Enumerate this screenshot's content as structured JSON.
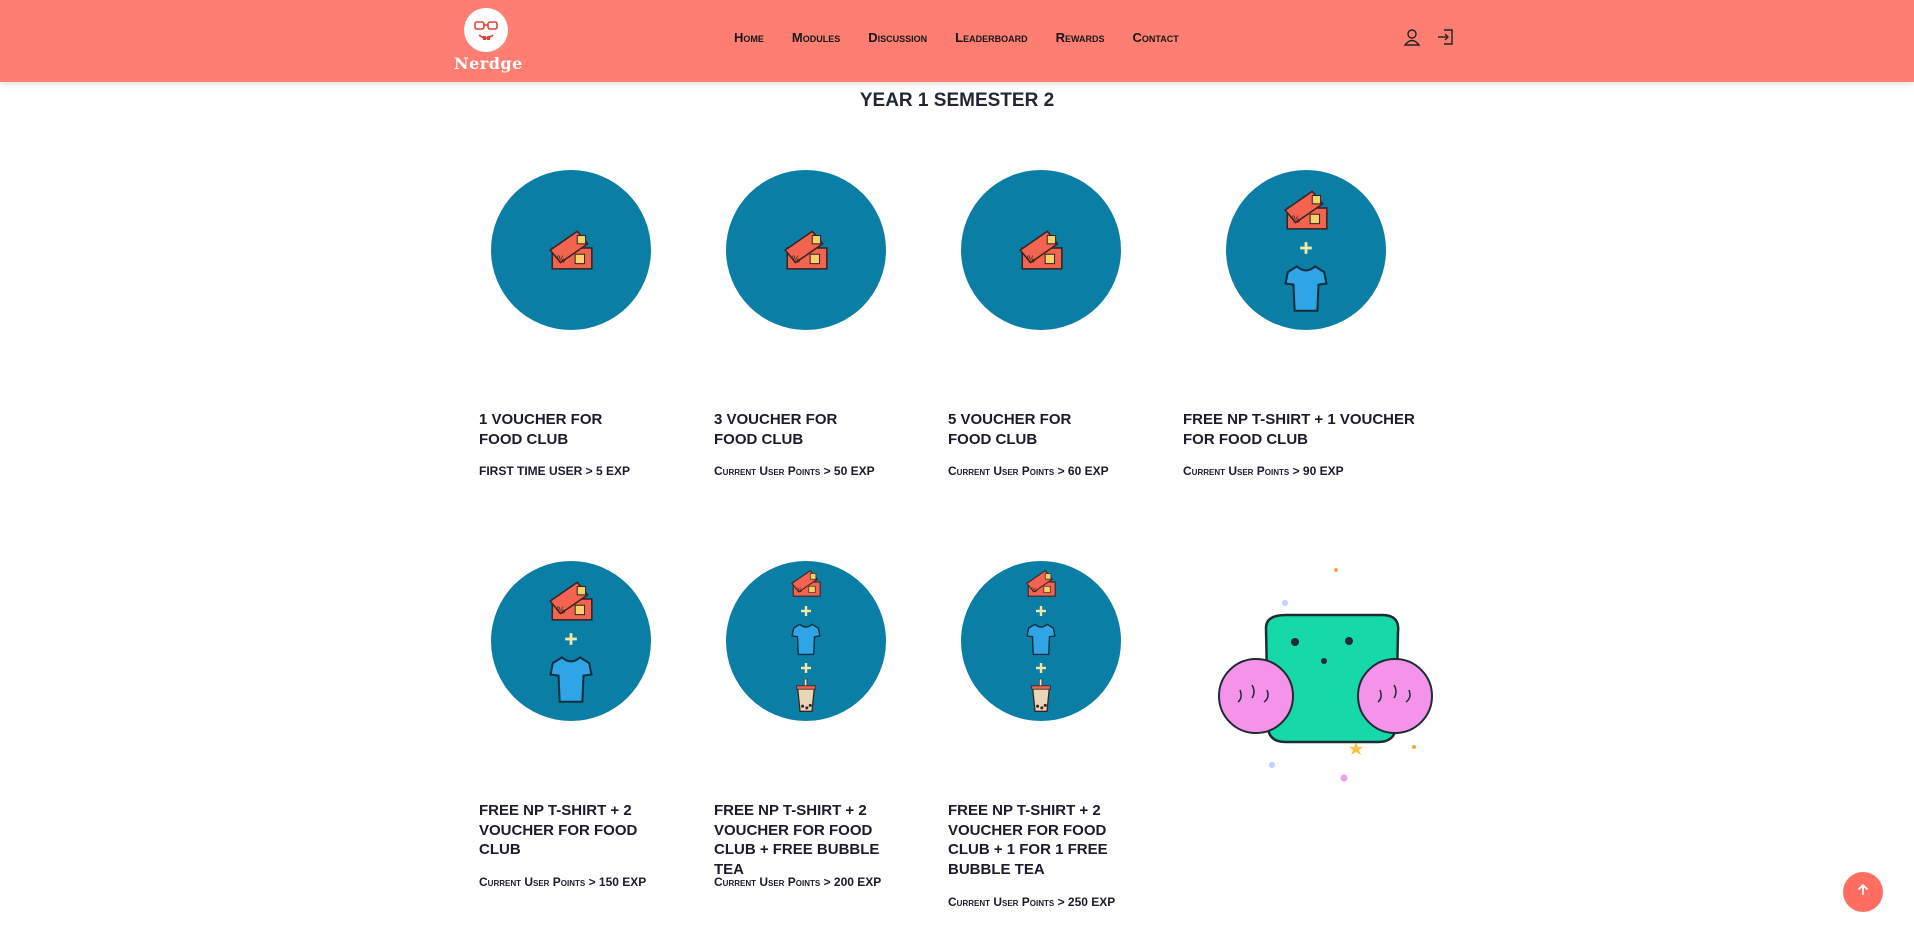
{
  "brand": {
    "name": "Nerdge"
  },
  "nav": {
    "items": [
      "Home",
      "Modules",
      "Discussion",
      "Leaderboard",
      "Rewards",
      "Contact"
    ]
  },
  "header_icons": [
    "user-icon",
    "login-icon"
  ],
  "page_title": "YEAR 1 SEMESTER 2",
  "rewards": [
    {
      "title": "1 VOUCHER FOR FOOD CLUB",
      "requirement": "FIRST TIME USER > 5 EXP",
      "icons": [
        "voucher"
      ]
    },
    {
      "title": "3 VOUCHER FOR FOOD CLUB",
      "requirement": "Current User Points > 50 EXP",
      "icons": [
        "voucher"
      ]
    },
    {
      "title": "5 VOUCHER FOR FOOD CLUB",
      "requirement": "Current User Points > 60 EXP",
      "icons": [
        "voucher"
      ]
    },
    {
      "title": "FREE NP T-SHIRT + 1 VOUCHER FOR FOOD CLUB",
      "requirement": "Current User Points > 90 EXP",
      "icons": [
        "voucher",
        "tshirt"
      ]
    },
    {
      "title": "FREE NP T-SHIRT + 2 VOUCHER FOR FOOD CLUB",
      "requirement": "Current User Points > 150 EXP",
      "icons": [
        "voucher",
        "tshirt"
      ]
    },
    {
      "title": "FREE NP T-SHIRT + 2 VOUCHER FOR FOOD CLUB + FREE BUBBLE TEA",
      "requirement": "Current User Points > 200 EXP",
      "icons": [
        "voucher",
        "tshirt",
        "bubble-tea"
      ]
    },
    {
      "title": "FREE NP T-SHIRT + 2 VOUCHER FOR FOOD CLUB + 1 FOR 1 FREE BUBBLE TEA",
      "requirement": "Current User Points > 250 EXP",
      "icons": [
        "voucher",
        "tshirt",
        "bubble-tea"
      ]
    }
  ],
  "colors": {
    "header_bg": "#ff7e73",
    "circle_bg": "#0b7ea6",
    "voucher": "#f2644f",
    "tshirt": "#2fa4e7",
    "scroll_button": "#ff6e60",
    "mascot_body": "#17d8a8",
    "mascot_pompom": "#f593ea"
  }
}
